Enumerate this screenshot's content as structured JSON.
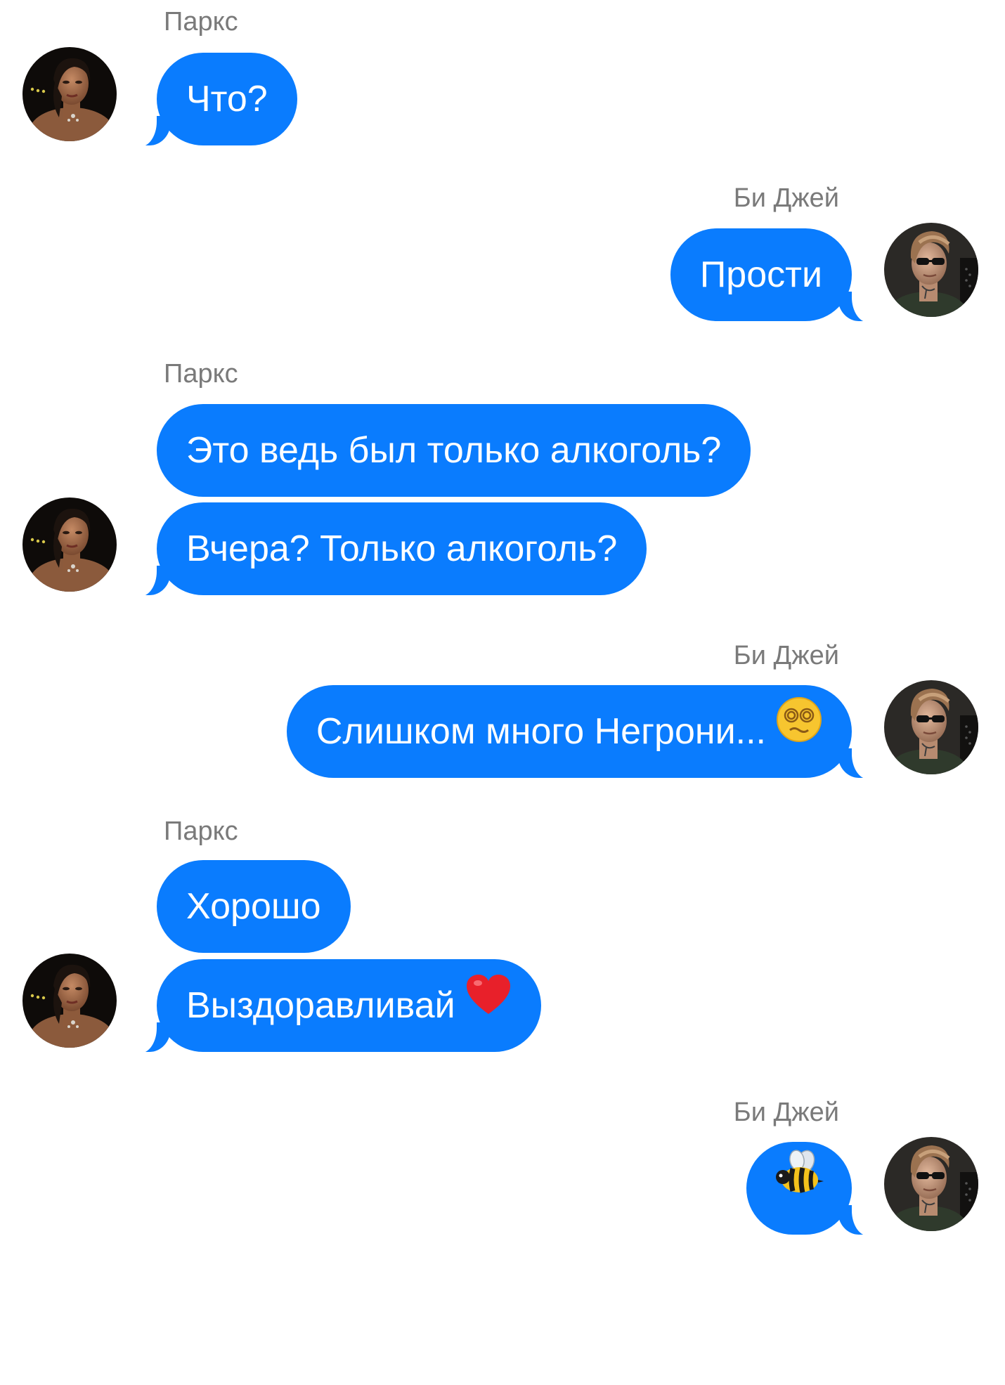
{
  "colors": {
    "bubble_blue": "#0a7cfe",
    "sender_gray": "#7a7a7a",
    "background": "#ffffff"
  },
  "participants": {
    "left": "Паркс",
    "right": "Би Джей"
  },
  "messages": [
    {
      "sender": "Паркс",
      "text": "Что?"
    },
    {
      "sender": "Би Джей",
      "text": "Прости"
    },
    {
      "sender": "Паркс",
      "text": "Это ведь был только алкоголь?"
    },
    {
      "sender": "Паркс",
      "text": "Вчера? Только алкоголь?"
    },
    {
      "sender": "Би Джей",
      "text": "Слишком много Негрони...",
      "emoji": "dizzy-face-emoji"
    },
    {
      "sender": "Паркс",
      "text": "Хорошо"
    },
    {
      "sender": "Паркс",
      "text": "Выздоравливай",
      "emoji": "red-heart-emoji"
    },
    {
      "sender": "Би Джей",
      "text": "",
      "emoji": "bee-emoji"
    }
  ],
  "icons": {
    "left_avatar": "woman-avatar",
    "right_avatar": "man-with-sunglasses-avatar"
  }
}
